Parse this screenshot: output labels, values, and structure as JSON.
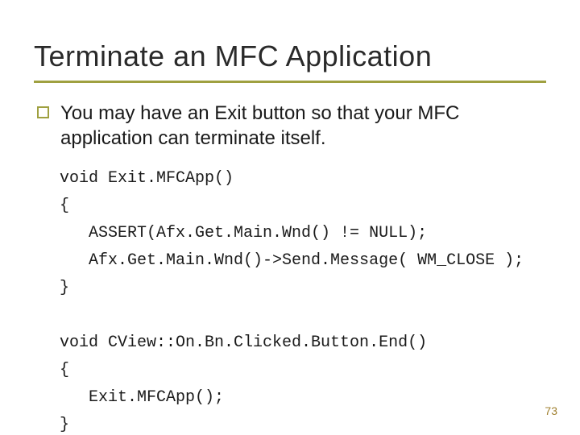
{
  "slide": {
    "title": "Terminate an MFC Application",
    "bullet1": "You may have an Exit button so that your MFC application can terminate itself.",
    "code": "void Exit.MFCApp()\n{\n   ASSERT(Afx.Get.Main.Wnd() != NULL);\n   Afx.Get.Main.Wnd()->Send.Message( WM_CLOSE );\n}\n\nvoid CView::On.Bn.Clicked.Button.End()\n{\n   Exit.MFCApp();\n}",
    "page": "73"
  }
}
